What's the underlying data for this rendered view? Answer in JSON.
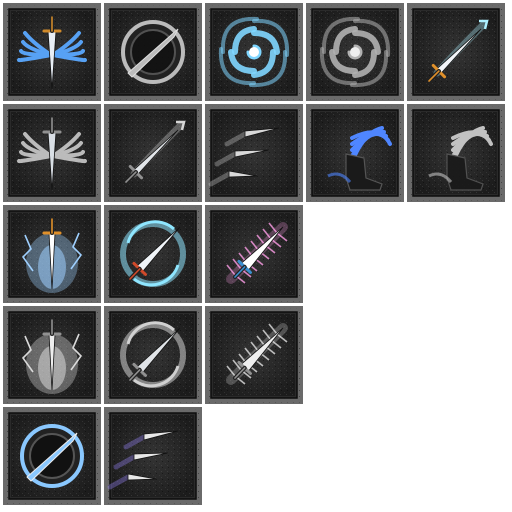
{
  "sheet": {
    "background": "#ffffff",
    "frame_outer": "#6a6a6a",
    "frame_inner": "#2a2a2a",
    "stone_dark": "#1c1c1c",
    "stone_mid": "#343434"
  },
  "rows": [
    [
      {
        "icon": "winged-sword-icon",
        "tint": "color",
        "accent": "#5aa8ff",
        "hilt": "#d08a2a"
      },
      {
        "icon": "slash-disc-icon",
        "tint": "gray",
        "accent": "#c8c8c8"
      },
      {
        "icon": "vortex-icon",
        "tint": "color",
        "accent": "#7fd6ff"
      },
      {
        "icon": "vortex-icon",
        "tint": "gray",
        "accent": "#bdbdbd"
      },
      {
        "icon": "sword-beam-icon",
        "tint": "color",
        "accent": "#aef0ff",
        "hilt": "#e0902a"
      }
    ],
    [
      {
        "icon": "winged-sword-icon",
        "tint": "gray",
        "accent": "#d0d0d0"
      },
      {
        "icon": "sword-beam-icon",
        "tint": "gray",
        "accent": "#e6e6e6"
      },
      {
        "icon": "flying-blades-icon",
        "tint": "gray",
        "accent": "#d8d8d8"
      },
      {
        "icon": "winged-boot-icon",
        "tint": "color",
        "accent": "#4f86ff"
      },
      {
        "icon": "winged-boot-icon",
        "tint": "gray",
        "accent": "#cfcfcf"
      }
    ],
    [
      {
        "icon": "lightning-sword-icon",
        "tint": "color",
        "accent": "#9fd0ff",
        "hilt": "#e0902a"
      },
      {
        "icon": "spin-slash-sword-icon",
        "tint": "color",
        "accent": "#8fe6ff",
        "hilt": "#d04a2a"
      },
      {
        "icon": "radiant-sword-icon",
        "tint": "color",
        "accent": "#ff9ee8",
        "hilt": "#3a8fd0"
      }
    ],
    [
      {
        "icon": "lightning-sword-icon",
        "tint": "gray",
        "accent": "#eaeaea"
      },
      {
        "icon": "spin-slash-sword-icon",
        "tint": "gray",
        "accent": "#e0e0e0"
      },
      {
        "icon": "radiant-sword-icon",
        "tint": "gray",
        "accent": "#f2f2f2"
      }
    ],
    [
      {
        "icon": "slash-disc-icon",
        "tint": "color",
        "accent": "#8ac8ff",
        "hilt": "#d0a03a"
      },
      {
        "icon": "flying-blades-icon",
        "tint": "color",
        "accent": "#9a86ff"
      }
    ]
  ]
}
